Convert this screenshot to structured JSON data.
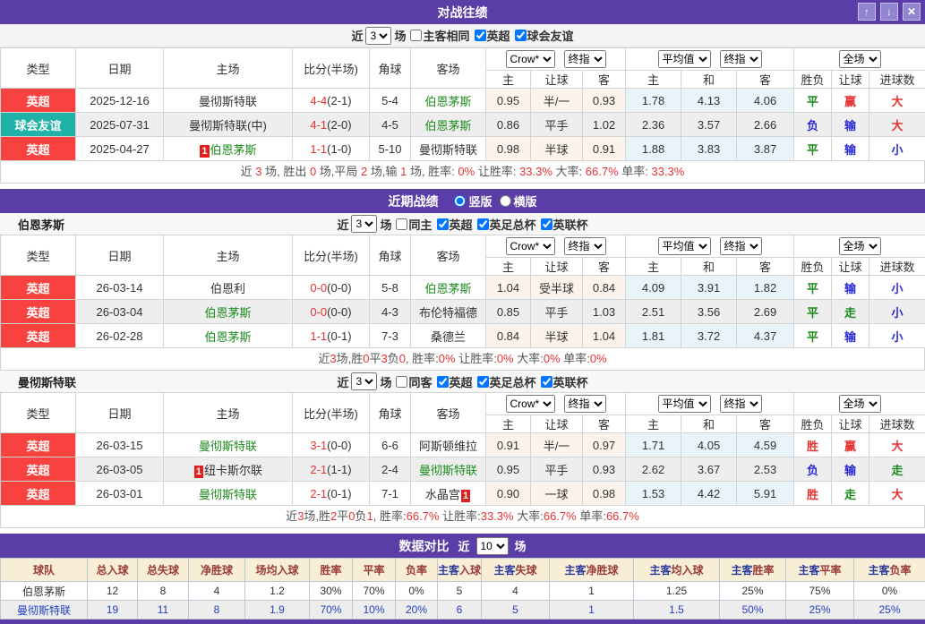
{
  "h2h": {
    "title": "对战往绩",
    "buttons": {
      "up": "↑",
      "down": "↓",
      "close": "✕"
    },
    "filter": {
      "prefix": "近",
      "count": "3",
      "suffix": "场",
      "checkboxes": [
        {
          "label": "主客相同",
          "checked": false
        },
        {
          "label": "英超",
          "checked": true
        },
        {
          "label": "球会友谊",
          "checked": true
        }
      ]
    },
    "rows": [
      {
        "league": "英超",
        "league_style": "red",
        "date": "2025-12-16",
        "home": {
          "name": "曼彻斯特联",
          "color": "dark"
        },
        "score": "4-4",
        "half": "(2-1)",
        "corners": "5-4",
        "away": {
          "name": "伯恩茅斯",
          "color": "green"
        },
        "odds": [
          "0.95",
          "半/一",
          "0.93"
        ],
        "avg": [
          "1.78",
          "4.13",
          "4.06"
        ],
        "results": [
          {
            "text": "平",
            "color": "green"
          },
          {
            "text": "赢",
            "color": "red"
          },
          {
            "text": "大",
            "color": "red"
          }
        ]
      },
      {
        "league": "球会友谊",
        "league_style": "teal",
        "date": "2025-07-31",
        "home": {
          "name": "曼彻斯特联(中)",
          "color": "dark"
        },
        "score": "4-1",
        "half": "(2-0)",
        "corners": "4-5",
        "away": {
          "name": "伯恩茅斯",
          "color": "green"
        },
        "odds": [
          "0.86",
          "平手",
          "1.02"
        ],
        "avg": [
          "2.36",
          "3.57",
          "2.66"
        ],
        "results": [
          {
            "text": "负",
            "color": "blue"
          },
          {
            "text": "输",
            "color": "blue"
          },
          {
            "text": "大",
            "color": "red"
          }
        ]
      },
      {
        "league": "英超",
        "league_style": "red",
        "date": "2025-04-27",
        "home": {
          "name": "伯恩茅斯",
          "color": "green",
          "badge_before": "1"
        },
        "score": "1-1",
        "half": "(1-0)",
        "corners": "5-10",
        "away": {
          "name": "曼彻斯特联",
          "color": "dark"
        },
        "odds": [
          "0.98",
          "半球",
          "0.91"
        ],
        "avg": [
          "1.88",
          "3.83",
          "3.87"
        ],
        "results": [
          {
            "text": "平",
            "color": "green"
          },
          {
            "text": "输",
            "color": "blue"
          },
          {
            "text": "小",
            "color": "blue"
          }
        ]
      }
    ],
    "summary": "近 3 场, 胜出 0 场,平局 2 场,输 1 场, 胜率: 0% 让胜率: 33.3% 大率: 66.7% 单率: 33.3%"
  },
  "shared_table_header": {
    "static": [
      "类型",
      "日期",
      "主场",
      "比分(半场)",
      "角球",
      "客场"
    ],
    "group1": {
      "selects": [
        "Crow*",
        "终指"
      ],
      "cols": [
        "主",
        "让球",
        "客"
      ]
    },
    "group2": {
      "selects": [
        "平均值",
        "终指"
      ],
      "cols": [
        "主",
        "和",
        "客"
      ]
    },
    "group3": {
      "selects": [
        "全场"
      ],
      "cols": [
        "胜负",
        "让球",
        "进球数"
      ]
    }
  },
  "recent": {
    "title": "近期战绩",
    "radios": [
      {
        "label": "竖版",
        "checked": true
      },
      {
        "label": "横版",
        "checked": false
      }
    ],
    "blocks": [
      {
        "team": "伯恩茅斯",
        "filter": {
          "prefix": "近",
          "count": "3",
          "suffix": "场",
          "checkboxes": [
            {
              "label": "同主",
              "checked": false
            },
            {
              "label": "英超",
              "checked": true
            },
            {
              "label": "英足总杯",
              "checked": true
            },
            {
              "label": "英联杯",
              "checked": true
            }
          ]
        },
        "rows": [
          {
            "league": "英超",
            "league_style": "red",
            "date": "26-03-14",
            "home": {
              "name": "伯恩利",
              "color": "dark"
            },
            "score": "0-0",
            "half": "(0-0)",
            "corners": "5-8",
            "away": {
              "name": "伯恩茅斯",
              "color": "green"
            },
            "odds": [
              "1.04",
              "受半球",
              "0.84"
            ],
            "avg": [
              "4.09",
              "3.91",
              "1.82"
            ],
            "results": [
              {
                "text": "平",
                "color": "green"
              },
              {
                "text": "输",
                "color": "blue"
              },
              {
                "text": "小",
                "color": "blue"
              }
            ]
          },
          {
            "league": "英超",
            "league_style": "red",
            "date": "26-03-04",
            "home": {
              "name": "伯恩茅斯",
              "color": "green"
            },
            "score": "0-0",
            "half": "(0-0)",
            "corners": "4-3",
            "away": {
              "name": "布伦特福德",
              "color": "dark"
            },
            "odds": [
              "0.85",
              "平手",
              "1.03"
            ],
            "avg": [
              "2.51",
              "3.56",
              "2.69"
            ],
            "results": [
              {
                "text": "平",
                "color": "green"
              },
              {
                "text": "走",
                "color": "green"
              },
              {
                "text": "小",
                "color": "blue"
              }
            ]
          },
          {
            "league": "英超",
            "league_style": "red",
            "date": "26-02-28",
            "home": {
              "name": "伯恩茅斯",
              "color": "green"
            },
            "score": "1-1",
            "half": "(0-1)",
            "corners": "7-3",
            "away": {
              "name": "桑德兰",
              "color": "dark"
            },
            "odds": [
              "0.84",
              "半球",
              "1.04"
            ],
            "avg": [
              "1.81",
              "3.72",
              "4.37"
            ],
            "results": [
              {
                "text": "平",
                "color": "green"
              },
              {
                "text": "输",
                "color": "blue"
              },
              {
                "text": "小",
                "color": "blue"
              }
            ]
          }
        ],
        "summary": "近3场,胜0平3负0, 胜率:0% 让胜率:0% 大率:0% 单率:0%"
      },
      {
        "team": "曼彻斯特联",
        "filter": {
          "prefix": "近",
          "count": "3",
          "suffix": "场",
          "checkboxes": [
            {
              "label": "同客",
              "checked": false
            },
            {
              "label": "英超",
              "checked": true
            },
            {
              "label": "英足总杯",
              "checked": true
            },
            {
              "label": "英联杯",
              "checked": true
            }
          ]
        },
        "rows": [
          {
            "league": "英超",
            "league_style": "red",
            "date": "26-03-15",
            "home": {
              "name": "曼彻斯特联",
              "color": "green"
            },
            "score": "3-1",
            "half": "(0-0)",
            "corners": "6-6",
            "away": {
              "name": "阿斯顿维拉",
              "color": "dark"
            },
            "odds": [
              "0.91",
              "半/一",
              "0.97"
            ],
            "avg": [
              "1.71",
              "4.05",
              "4.59"
            ],
            "results": [
              {
                "text": "胜",
                "color": "red"
              },
              {
                "text": "赢",
                "color": "red"
              },
              {
                "text": "大",
                "color": "red"
              }
            ]
          },
          {
            "league": "英超",
            "league_style": "red",
            "date": "26-03-05",
            "home": {
              "name": "纽卡斯尔联",
              "color": "dark",
              "badge_before": "1"
            },
            "score": "2-1",
            "half": "(1-1)",
            "corners": "2-4",
            "away": {
              "name": "曼彻斯特联",
              "color": "green"
            },
            "odds": [
              "0.95",
              "平手",
              "0.93"
            ],
            "avg": [
              "2.62",
              "3.67",
              "2.53"
            ],
            "results": [
              {
                "text": "负",
                "color": "blue"
              },
              {
                "text": "输",
                "color": "blue"
              },
              {
                "text": "走",
                "color": "green"
              }
            ]
          },
          {
            "league": "英超",
            "league_style": "red",
            "date": "26-03-01",
            "home": {
              "name": "曼彻斯特联",
              "color": "green"
            },
            "score": "2-1",
            "half": "(0-1)",
            "corners": "7-1",
            "away": {
              "name": "水晶宫",
              "color": "dark",
              "badge_after": "1"
            },
            "odds": [
              "0.90",
              "一球",
              "0.98"
            ],
            "avg": [
              "1.53",
              "4.42",
              "5.91"
            ],
            "results": [
              {
                "text": "胜",
                "color": "red"
              },
              {
                "text": "走",
                "color": "green"
              },
              {
                "text": "大",
                "color": "red"
              }
            ]
          }
        ],
        "summary": "近3场,胜2平0负1, 胜率:66.7% 让胜率:33.3% 大率:66.7% 单率:66.7%"
      }
    ]
  },
  "comparison": {
    "title": "数据对比",
    "near_prefix": "近",
    "near_count": "10",
    "near_suffix": "场",
    "headers": [
      {
        "pre": "",
        "label": "球队"
      },
      {
        "pre": "",
        "label": "总入球"
      },
      {
        "pre": "",
        "label": "总失球"
      },
      {
        "pre": "",
        "label": "净胜球"
      },
      {
        "pre": "",
        "label": "场均入球"
      },
      {
        "pre": "",
        "label": "胜率"
      },
      {
        "pre": "",
        "label": "平率"
      },
      {
        "pre": "",
        "label": "负率"
      },
      {
        "pre": "主客",
        "label": "入球"
      },
      {
        "pre": "主客",
        "label": "失球"
      },
      {
        "pre": "主客",
        "label": "净胜球"
      },
      {
        "pre": "主客",
        "label": "均入球"
      },
      {
        "pre": "主客",
        "label": "胜率"
      },
      {
        "pre": "主客",
        "label": "平率"
      },
      {
        "pre": "主客",
        "label": "负率"
      }
    ],
    "rows": [
      {
        "team": "伯恩茅斯",
        "style": "dark",
        "values": [
          "12",
          "8",
          "4",
          "1.2",
          "30%",
          "70%",
          "0%",
          "5",
          "4",
          "1",
          "1.25",
          "25%",
          "75%",
          "0%"
        ]
      },
      {
        "team": "曼彻斯特联",
        "style": "blue",
        "values": [
          "19",
          "11",
          "8",
          "1.9",
          "70%",
          "10%",
          "20%",
          "6",
          "5",
          "1",
          "1.5",
          "50%",
          "25%",
          "25%"
        ]
      }
    ]
  }
}
